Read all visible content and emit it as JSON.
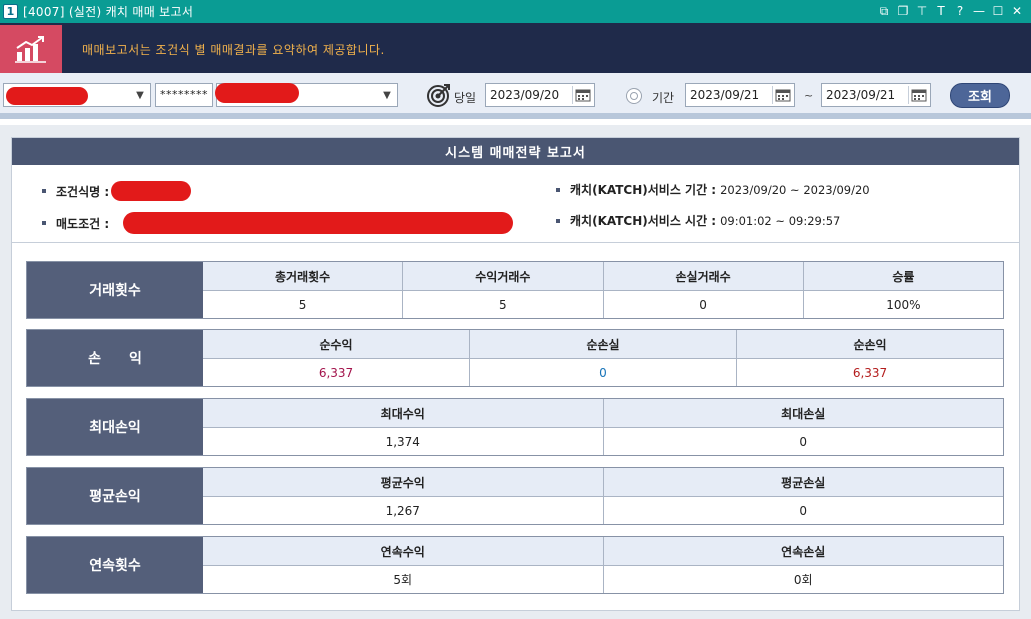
{
  "window": {
    "number": "1",
    "title": "[4007] (실전) 캐치 매매 보고서"
  },
  "banner": {
    "description": "매매보고서는 조건식 별 매매결과를 요약하여 제공합니다."
  },
  "toolbar": {
    "password_mask": "********",
    "today_label": "당일",
    "today_date": "2023/09/20",
    "period_label": "기간",
    "period_start": "2023/09/21",
    "period_sep": "~",
    "period_end": "2023/09/21",
    "query_button": "조회"
  },
  "report": {
    "title": "시스템 매매전략 보고서",
    "condition_name_label": "조건식명 :",
    "sell_condition_label": "매도조건 :",
    "service_period_label": "캐치(KATCH)서비스 기간 :",
    "service_period_value": "2023/09/20 ~ 2023/09/20",
    "service_time_label": "캐치(KATCH)서비스 시간 :",
    "service_time_value": "09:01:02 ~ 09:29:57"
  },
  "stats": {
    "trades": {
      "head": "거래횟수",
      "cols": [
        {
          "label": "총거래횟수",
          "value": "5"
        },
        {
          "label": "수익거래수",
          "value": "5"
        },
        {
          "label": "손실거래수",
          "value": "0"
        },
        {
          "label": "승률",
          "value": "100%"
        }
      ]
    },
    "pnl": {
      "head": "손　　익",
      "cols": [
        {
          "label": "순수익",
          "value": "6,337"
        },
        {
          "label": "순손실",
          "value": "0"
        },
        {
          "label": "순손익",
          "value": "6,337"
        }
      ]
    },
    "max": {
      "head": "최대손익",
      "cols": [
        {
          "label": "최대수익",
          "value": "1,374"
        },
        {
          "label": "최대손실",
          "value": "0"
        }
      ]
    },
    "avg": {
      "head": "평균손익",
      "cols": [
        {
          "label": "평균수익",
          "value": "1,267"
        },
        {
          "label": "평균손실",
          "value": "0"
        }
      ]
    },
    "streak": {
      "head": "연속횟수",
      "cols": [
        {
          "label": "연속수익",
          "value": "5회"
        },
        {
          "label": "연속손실",
          "value": "0회"
        }
      ]
    }
  },
  "colors": {
    "titlebar": "#0a9c94",
    "banner": "#1f2a4a",
    "profit": "#a3134b",
    "zero_loss": "#1673b8",
    "net": "#b31c1c",
    "redaction": "#e21a1a"
  }
}
